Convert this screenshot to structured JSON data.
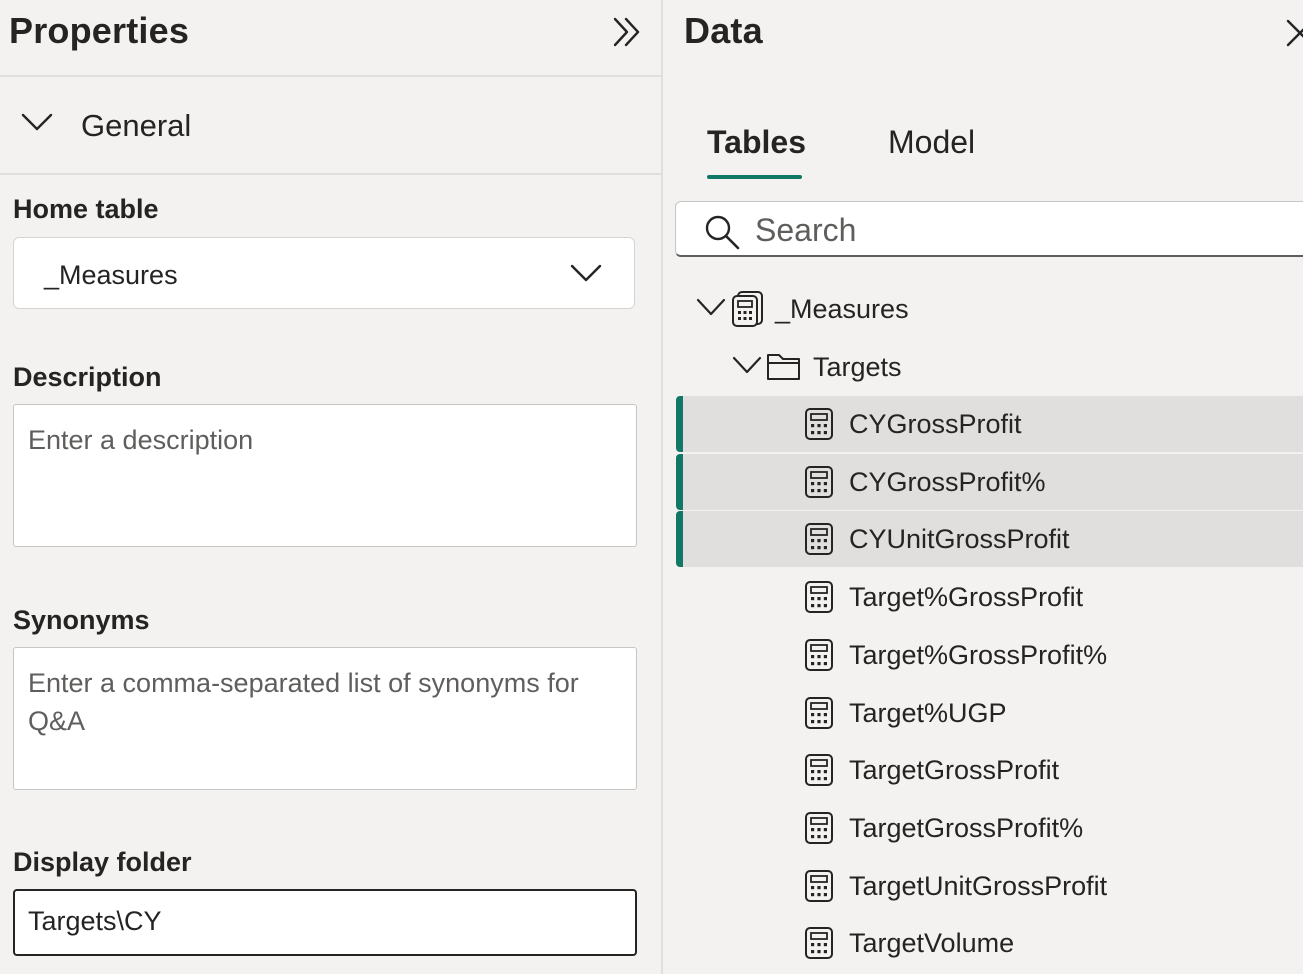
{
  "properties": {
    "title": "Properties",
    "collapse_icon": "double-chevron-right-icon",
    "section": {
      "label": "General",
      "icon": "chevron-down-icon"
    },
    "home_table": {
      "label": "Home table",
      "value": "_Measures",
      "icon": "chevron-down-icon"
    },
    "description": {
      "label": "Description",
      "placeholder": "Enter a description"
    },
    "synonyms": {
      "label": "Synonyms",
      "placeholder": "Enter a comma-separated list of synonyms for Q&A"
    },
    "display_folder": {
      "label": "Display folder",
      "value": "Targets\\CY"
    }
  },
  "data_pane": {
    "title": "Data",
    "close_icon": "close-icon",
    "tabs": [
      {
        "label": "Tables",
        "active": true
      },
      {
        "label": "Model",
        "active": false
      }
    ],
    "search": {
      "placeholder": "Search",
      "icon": "search-icon"
    },
    "tree": {
      "table": {
        "label": "_Measures",
        "icon": "measure-table-icon",
        "expanded": true
      },
      "folder": {
        "label": "Targets",
        "icon": "folder-icon",
        "expanded": true
      },
      "measures": [
        {
          "label": "CYGrossProfit",
          "selected": true
        },
        {
          "label": "CYGrossProfit%",
          "selected": true
        },
        {
          "label": "CYUnitGrossProfit",
          "selected": true
        },
        {
          "label": "Target%GrossProfit",
          "selected": false
        },
        {
          "label": "Target%GrossProfit%",
          "selected": false
        },
        {
          "label": "Target%UGP",
          "selected": false
        },
        {
          "label": "TargetGrossProfit",
          "selected": false
        },
        {
          "label": "TargetGrossProfit%",
          "selected": false
        },
        {
          "label": "TargetUnitGrossProfit",
          "selected": false
        },
        {
          "label": "TargetVolume",
          "selected": false
        }
      ],
      "measure_icon": "calculator-icon"
    }
  },
  "colors": {
    "accent": "#117865",
    "background": "#f3f2f1",
    "selected_row": "#e1dfdd",
    "text": "#252423"
  }
}
